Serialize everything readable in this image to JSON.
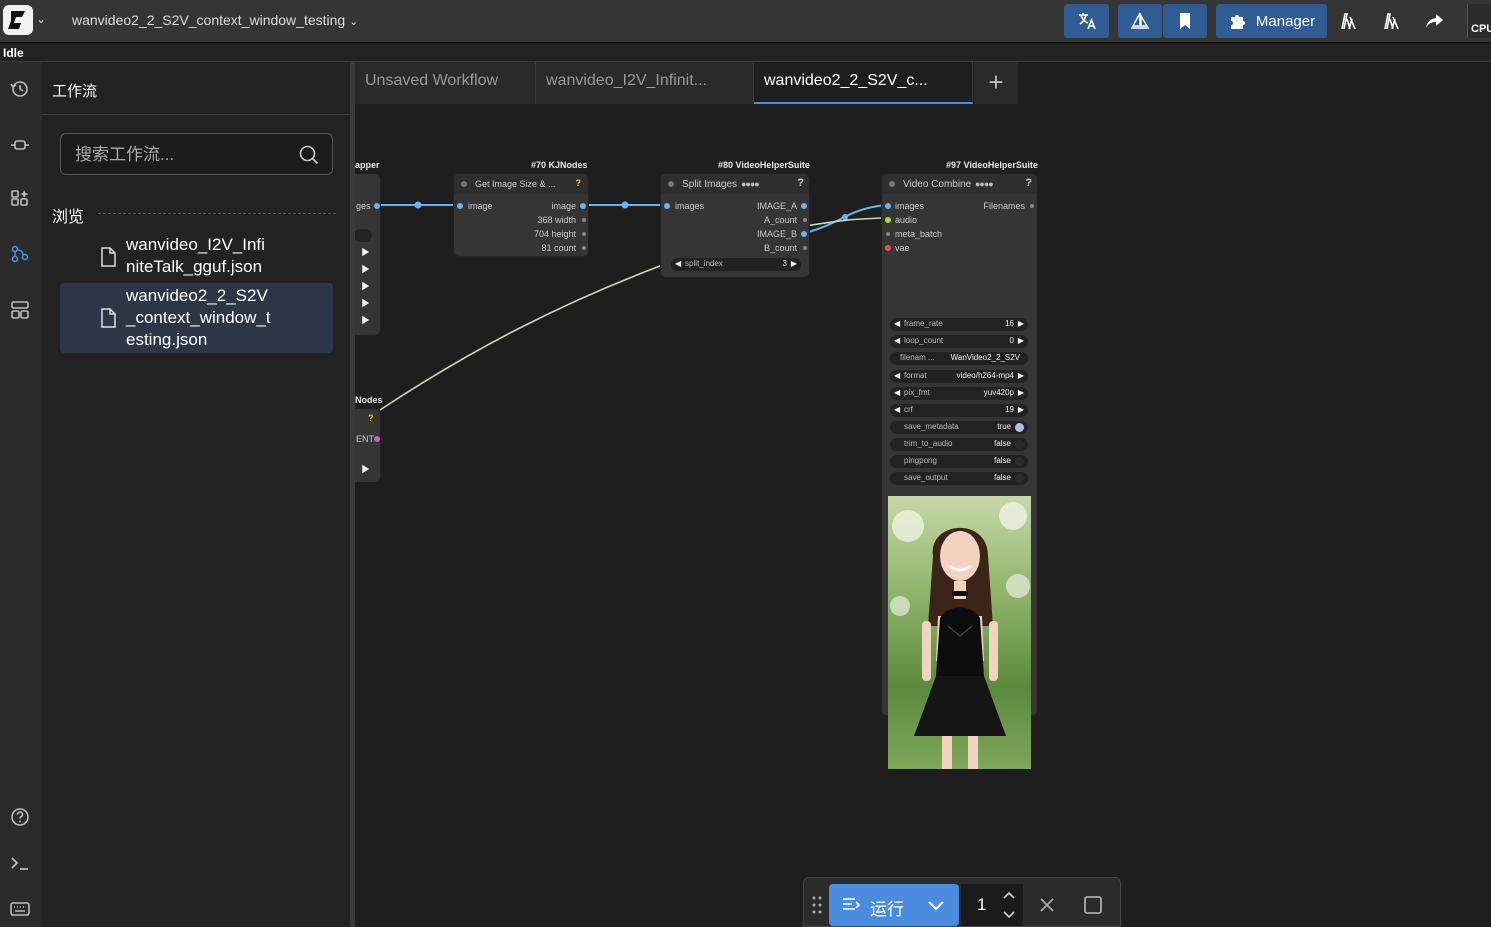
{
  "app": {
    "workflow_title": "wanvideo2_2_S2V_context_window_testing",
    "status": "Idle",
    "manager_label": "Manager",
    "cpu_label": "CPU"
  },
  "panel": {
    "title": "工作流",
    "search_placeholder": "搜索工作流...",
    "browse_label": "浏览",
    "files": [
      {
        "line1": "wanvideo_I2V_Infi",
        "line2": "niteTalk_gguf.json",
        "line3": ""
      },
      {
        "line1": "wanvideo2_2_S2V",
        "line2": "_context_window_t",
        "line3": "esting.json"
      }
    ]
  },
  "tabs": [
    {
      "label": "Unsaved Workflow"
    },
    {
      "label": "wanvideo_I2V_Infinit..."
    },
    {
      "label": "wanvideo2_2_S2V_c..."
    }
  ],
  "nodes": {
    "partial_top": {
      "source": "apper",
      "slot": "ges"
    },
    "partial_bottom": {
      "source": "Nodes",
      "slot": "ENT",
      "badge": "?"
    },
    "get_image_size": {
      "source": "#70 KJNodes",
      "title": "Get Image Size & ...",
      "badge": "?",
      "input": "image",
      "outputs": [
        "image",
        "368 width",
        "704 height",
        "81 count"
      ]
    },
    "split_images": {
      "source": "#80 VideoHelperSuite",
      "title": "Split Images",
      "badge": "?",
      "input": "images",
      "outputs": [
        "IMAGE_A",
        "A_count",
        "IMAGE_B",
        "B_count"
      ],
      "widget_label": "split_index",
      "widget_value": "3"
    },
    "video_combine": {
      "source": "#97 VideoHelperSuite",
      "title": "Video Combine",
      "badge": "?",
      "inputs": [
        "images",
        "audio",
        "meta_batch",
        "vae"
      ],
      "output": "Filenames",
      "widgets": [
        {
          "label": "frame_rate",
          "value": "16"
        },
        {
          "label": "loop_count",
          "value": "0"
        },
        {
          "label": "filenam ...",
          "value": "WanVideo2_2_S2V"
        },
        {
          "label": "format",
          "value": "video/h264-mp4"
        },
        {
          "label": "pix_fmt",
          "value": "yuv420p"
        },
        {
          "label": "crf",
          "value": "19"
        },
        {
          "label": "save_metadata",
          "value": "true"
        },
        {
          "label": "trim_to_audio",
          "value": "false"
        },
        {
          "label": "pingpong",
          "value": "false"
        },
        {
          "label": "save_output",
          "value": "false"
        }
      ]
    }
  },
  "runbar": {
    "run_label": "运行",
    "quantity": "1"
  },
  "colors": {
    "accent": "#4a8dde",
    "link_blue": "#64b5f6",
    "link_gray": "#c9d6c0"
  }
}
